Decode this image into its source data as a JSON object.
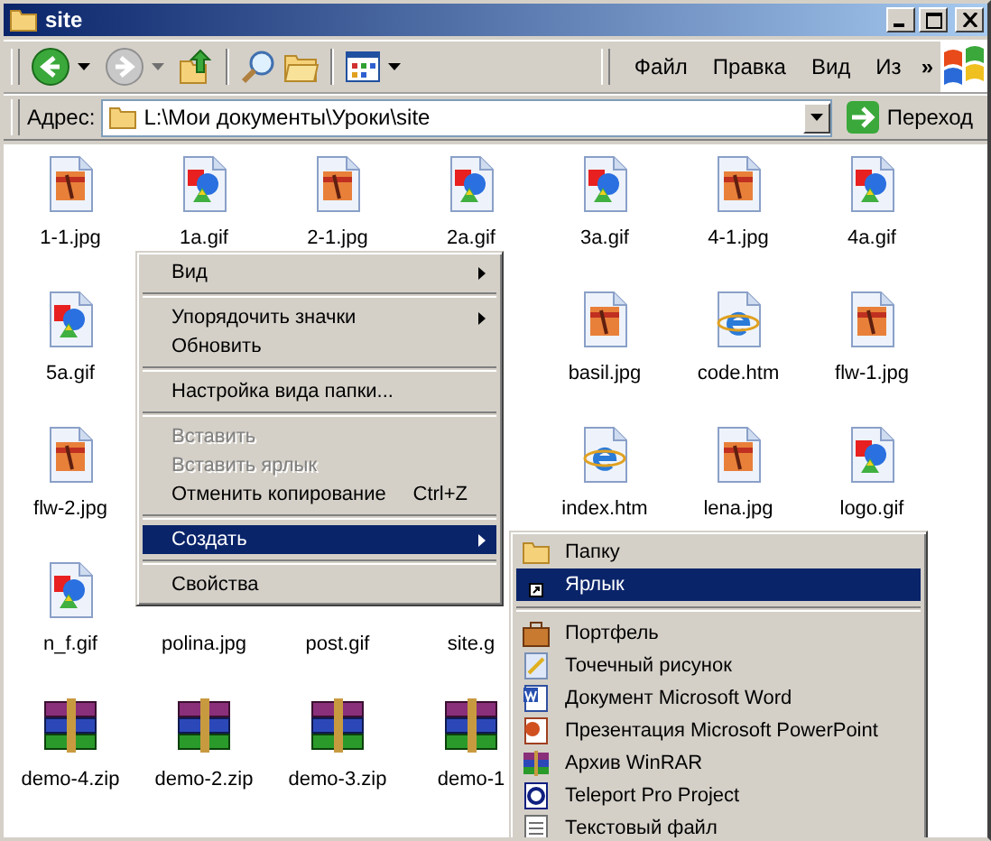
{
  "window": {
    "title": "site"
  },
  "toolbar": {
    "menu": [
      "Файл",
      "Правка",
      "Вид",
      "Из"
    ],
    "chevron": "»"
  },
  "address": {
    "label": "Адрес:",
    "value": "L:\\Мои документы\\Уроки\\site",
    "go": "Переход"
  },
  "files": [
    [
      {
        "name": "1-1.jpg",
        "kind": "jpg"
      },
      {
        "name": "1a.gif",
        "kind": "gif"
      },
      {
        "name": "2-1.jpg",
        "kind": "jpg"
      },
      {
        "name": "2a.gif",
        "kind": "gif"
      },
      {
        "name": "3a.gif",
        "kind": "gif"
      },
      {
        "name": "4-1.jpg",
        "kind": "jpg"
      },
      {
        "name": "4a.gif",
        "kind": "gif"
      }
    ],
    [
      {
        "name": "5a.gif",
        "kind": "gif"
      },
      {
        "kind": "covered"
      },
      {
        "kind": "covered"
      },
      {
        "kind": "covered"
      },
      {
        "name": "basil.jpg",
        "kind": "jpg"
      },
      {
        "name": "code.htm",
        "kind": "htm"
      },
      {
        "name": "flw-1.jpg",
        "kind": "jpg"
      }
    ],
    [
      {
        "name": "flw-2.jpg",
        "kind": "jpg"
      },
      {
        "kind": "covered"
      },
      {
        "kind": "covered"
      },
      {
        "kind": "covered"
      },
      {
        "name": "index.htm",
        "kind": "htm"
      },
      {
        "name": "lena.jpg",
        "kind": "jpg"
      },
      {
        "name": "logo.gif",
        "kind": "gif"
      }
    ],
    [
      {
        "name": "n_f.gif",
        "kind": "gif"
      },
      {
        "name": "polina.jpg",
        "kind": "none"
      },
      {
        "name": "post.gif",
        "kind": "none"
      },
      {
        "name": "site.g",
        "kind": "none"
      }
    ],
    [
      {
        "name": "demo-4.zip",
        "kind": "zip"
      },
      {
        "name": "demo-2.zip",
        "kind": "zip"
      },
      {
        "name": "demo-3.zip",
        "kind": "zip"
      },
      {
        "name": "demo-1",
        "kind": "zip"
      }
    ]
  ],
  "context_menu": [
    {
      "kind": "item",
      "label": "Вид",
      "submenu": true,
      "disabled": false,
      "selected": false
    },
    {
      "kind": "separator"
    },
    {
      "kind": "item",
      "label": "Упорядочить значки",
      "submenu": true,
      "disabled": false,
      "selected": false
    },
    {
      "kind": "item",
      "label": "Обновить",
      "submenu": false,
      "disabled": false,
      "selected": false
    },
    {
      "kind": "separator"
    },
    {
      "kind": "item",
      "label": "Настройка вида папки...",
      "submenu": false,
      "disabled": false,
      "selected": false
    },
    {
      "kind": "separator"
    },
    {
      "kind": "item",
      "label": "Вставить",
      "submenu": false,
      "disabled": true,
      "selected": false
    },
    {
      "kind": "item",
      "label": "Вставить ярлык",
      "submenu": false,
      "disabled": true,
      "selected": false
    },
    {
      "kind": "item",
      "label": "Отменить копирование",
      "shortcut": "Ctrl+Z",
      "submenu": false,
      "disabled": false,
      "selected": false
    },
    {
      "kind": "separator"
    },
    {
      "kind": "item",
      "label": "Создать",
      "submenu": true,
      "disabled": false,
      "selected": true
    },
    {
      "kind": "separator"
    },
    {
      "kind": "item",
      "label": "Свойства",
      "submenu": false,
      "disabled": false,
      "selected": false
    }
  ],
  "create_submenu": [
    {
      "kind": "folder",
      "label": "Папку",
      "selected": false
    },
    {
      "kind": "shortcut",
      "label": "Ярлык",
      "selected": true
    },
    {
      "kind": "separator"
    },
    {
      "kind": "briefcase",
      "label": "Портфель",
      "selected": false
    },
    {
      "kind": "bitmap",
      "label": "Точечный рисунок",
      "selected": false
    },
    {
      "kind": "word",
      "label": "Документ Microsoft Word",
      "selected": false
    },
    {
      "kind": "powerpoint",
      "label": "Презентация Microsoft PowerPoint",
      "selected": false
    },
    {
      "kind": "winrar",
      "label": "Архив WinRAR",
      "selected": false
    },
    {
      "kind": "teleport",
      "label": "Teleport Pro Project",
      "selected": false
    },
    {
      "kind": "text",
      "label": "Текстовый файл",
      "selected": false
    }
  ]
}
